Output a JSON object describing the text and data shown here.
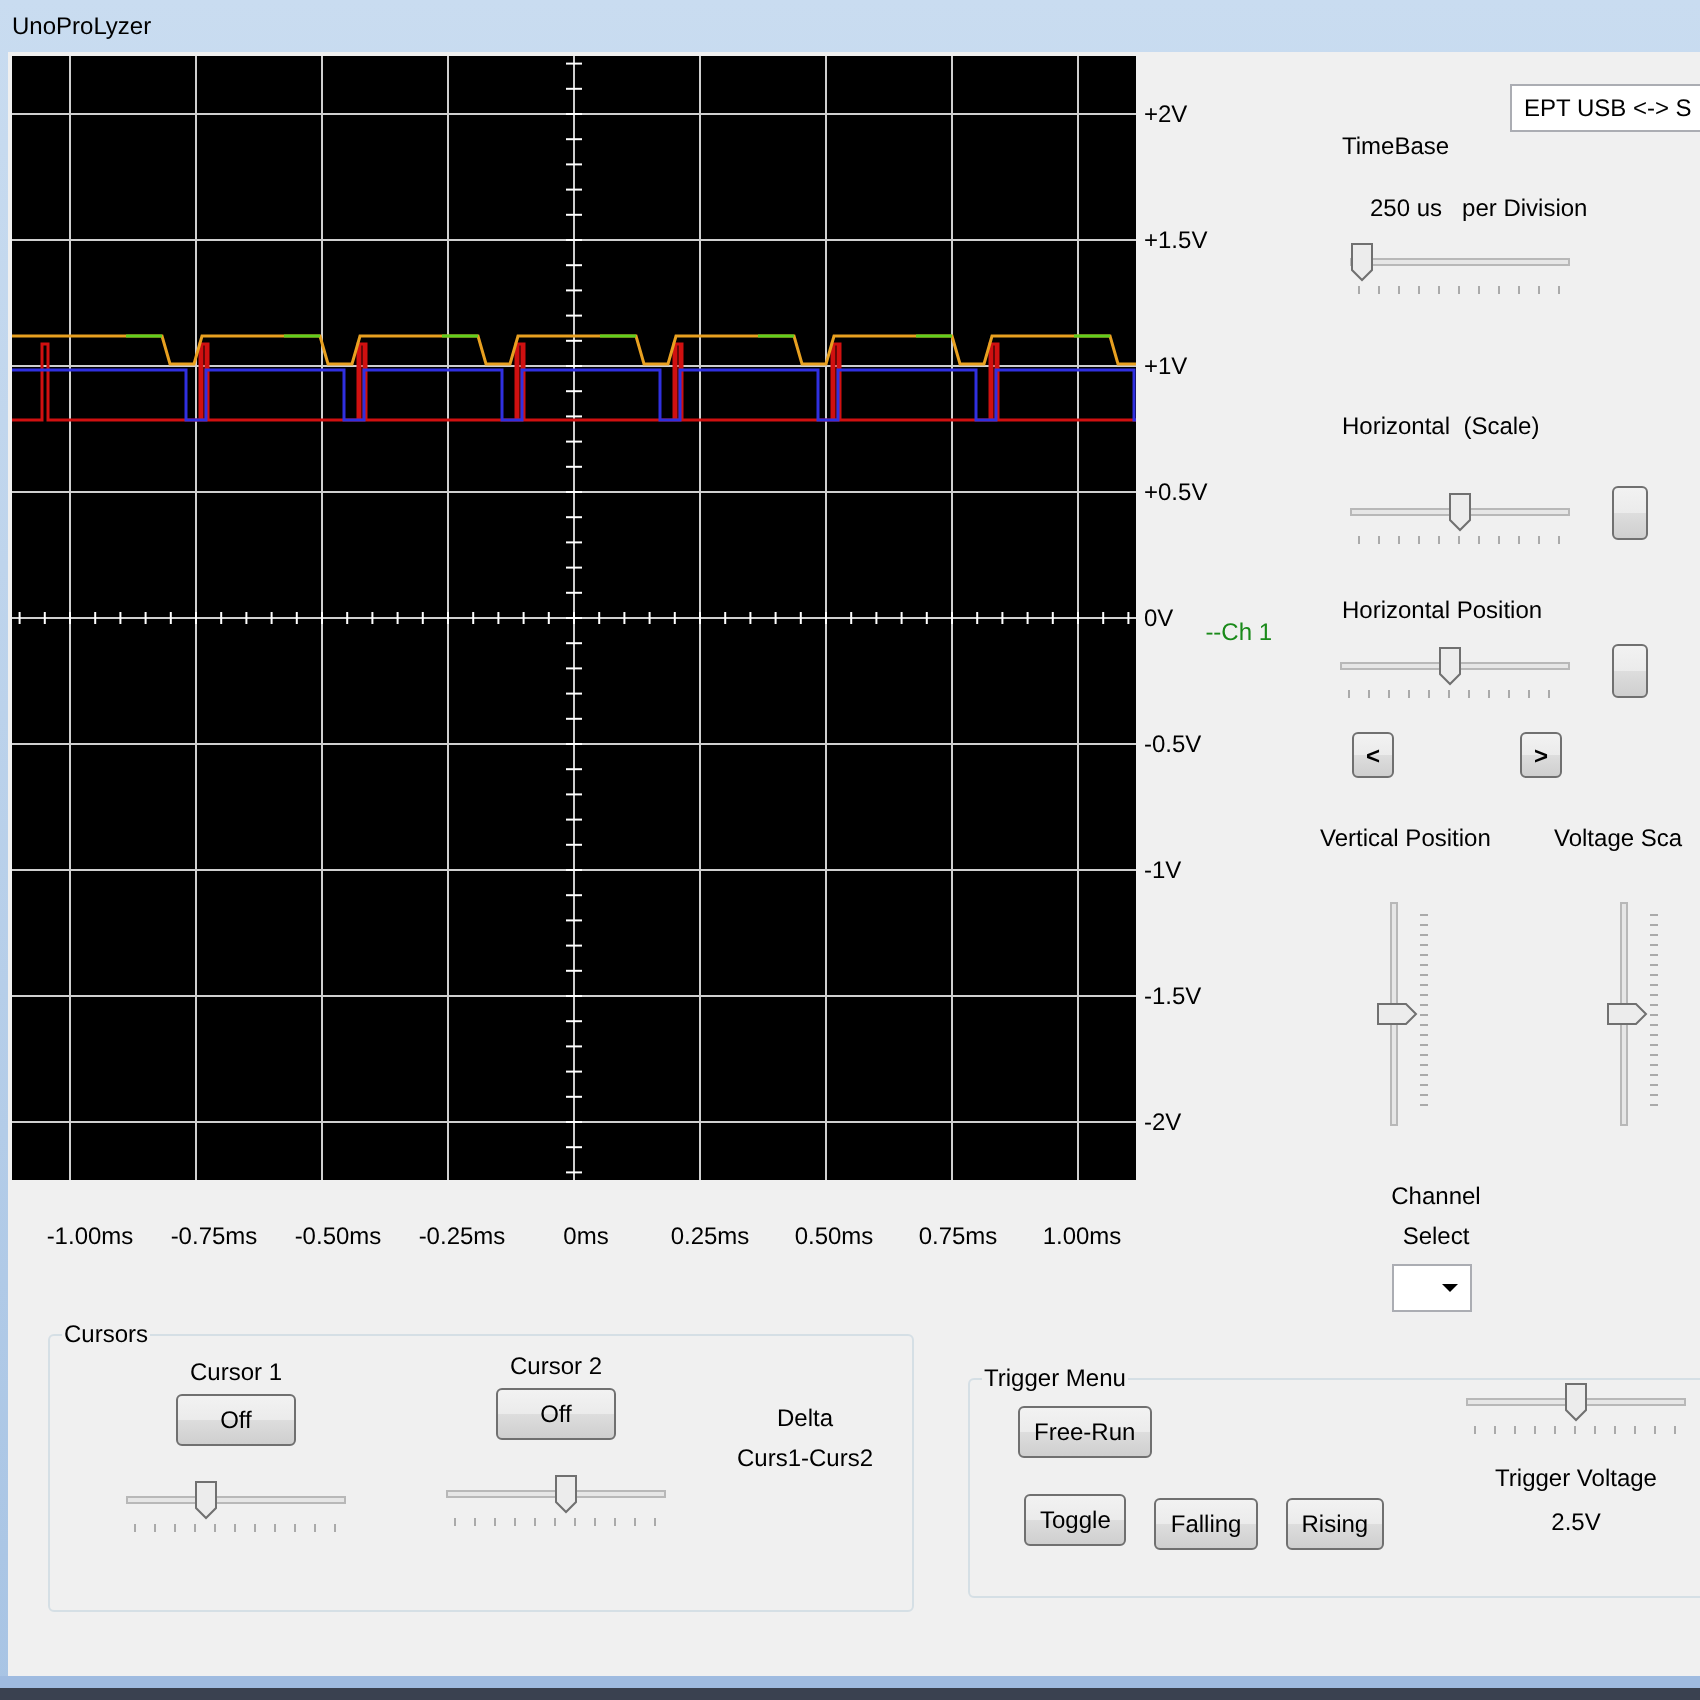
{
  "window": {
    "title": "UnoProLyzer"
  },
  "scope": {
    "voltage_labels": [
      {
        "text": "+2V"
      },
      {
        "text": "+1.5V"
      },
      {
        "text": "+1V"
      },
      {
        "text": "+0.5V"
      },
      {
        "text": "0V",
        "marker": "--Ch 1"
      },
      {
        "text": "-0.5V"
      },
      {
        "text": "-1V"
      },
      {
        "text": "-1.5V"
      },
      {
        "text": "-2V"
      }
    ],
    "time_labels": [
      "-1.00ms",
      "-0.75ms",
      "-0.50ms",
      "-0.25ms",
      "0ms",
      "0.25ms",
      "0.50ms",
      "0.75ms",
      "1.00ms"
    ]
  },
  "port_select": {
    "value": "EPT USB <-> S"
  },
  "timebase": {
    "title": "TimeBase",
    "value": "250 us",
    "unit": "per Division",
    "level": 0
  },
  "horizontal_scale": {
    "label": "Horizontal  (Scale)",
    "level": 0.5
  },
  "horizontal_position": {
    "label": "Horizontal Position",
    "level": 0.48,
    "buttons": [
      "<",
      ">"
    ]
  },
  "vertical": [
    {
      "label": "Vertical Position",
      "level": 0.5
    },
    {
      "label": "Voltage Sca",
      "level": 0.5
    }
  ],
  "channel_select": {
    "label": "Channel Select"
  },
  "cursors": {
    "title": "Cursors",
    "items": [
      {
        "label": "Cursor 1",
        "button": "Off",
        "level": 0.35
      },
      {
        "label": "Cursor 2",
        "button": "Off",
        "level": 0.55
      }
    ],
    "delta": [
      "Delta",
      "Curs1-Curs2"
    ]
  },
  "trigger": {
    "title": "Trigger Menu",
    "mode_button": "Free-Run",
    "edge_buttons": [
      "Toggle",
      "Falling",
      "Rising"
    ],
    "voltage_label": "Trigger Voltage",
    "voltage_value": "2.5V",
    "level": 0.5
  }
}
